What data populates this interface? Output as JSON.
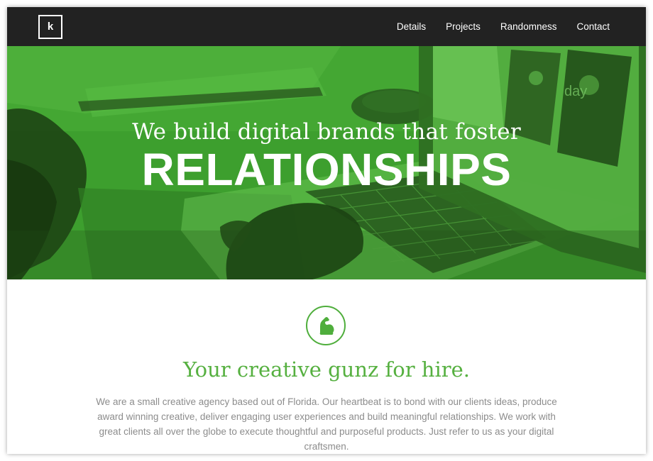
{
  "brand": {
    "logo_text": "k"
  },
  "nav": {
    "items": [
      {
        "label": "Details"
      },
      {
        "label": "Projects"
      },
      {
        "label": "Randomness"
      },
      {
        "label": "Contact"
      }
    ]
  },
  "hero": {
    "subtitle": "We build digital brands that foster",
    "title": "RELATIONSHIPS",
    "overlay_color": "#3fa22f"
  },
  "intro": {
    "icon": "flexed-bicep-icon",
    "heading": "Your creative gunz for hire.",
    "body": "We are a small creative agency based out of Florida. Our heartbeat is to bond with our clients ideas, produce award winning creative, deliver engaging user experiences and build meaningful relationships. We work with great clients all over the globe to execute thoughtful and purposeful products. Just refer to us as your digital craftsmen.",
    "accent_color": "#56b040"
  }
}
